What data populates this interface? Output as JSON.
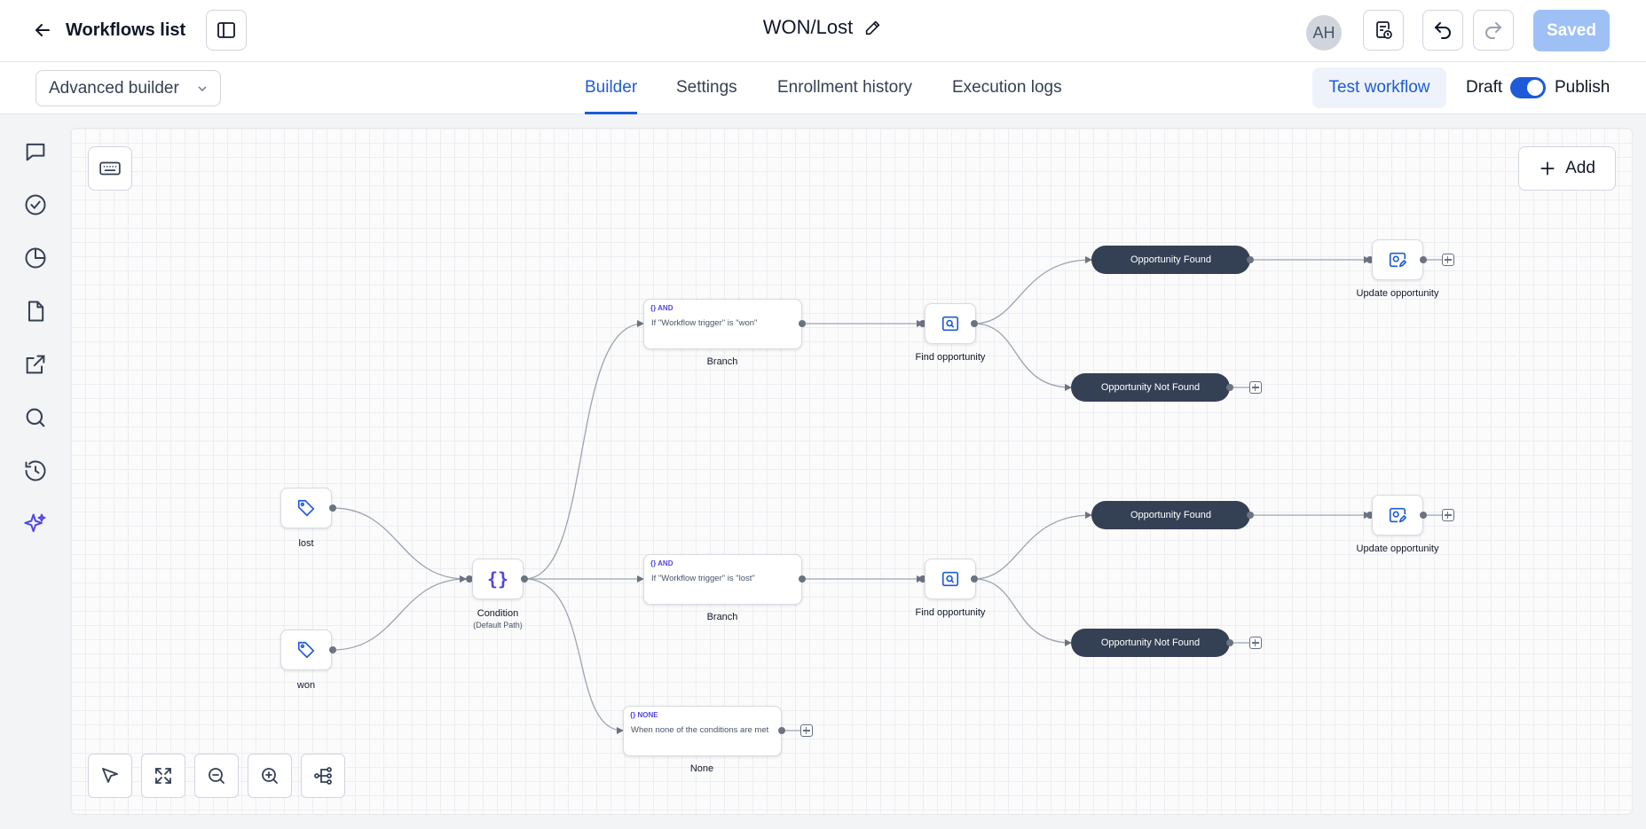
{
  "header": {
    "back_label": "Workflows list",
    "workflow_title": "WON/Lost",
    "avatar_initials": "AH",
    "saved_label": "Saved"
  },
  "nav": {
    "builder_select": "Advanced builder",
    "tabs": [
      {
        "label": "Builder",
        "active": true
      },
      {
        "label": "Settings",
        "active": false
      },
      {
        "label": "Enrollment history",
        "active": false
      },
      {
        "label": "Execution logs",
        "active": false
      }
    ],
    "test_workflow_label": "Test workflow",
    "draft_label": "Draft",
    "publish_label": "Publish",
    "publish_toggle_on": true
  },
  "sidebar": {
    "icons": [
      "chat-bubble-icon",
      "check-circle-icon",
      "pie-chart-icon",
      "document-icon",
      "external-link-icon",
      "search-icon",
      "history-icon",
      "sparkle-icon"
    ]
  },
  "canvas": {
    "add_label": "Add",
    "nodes": {
      "trigger_lost": "lost",
      "trigger_won": "won",
      "condition": "Condition",
      "condition_sub": "(Default Path)",
      "branch_won_tag": "AND",
      "branch_won_text": "If \"Workflow trigger\" is \"won\"",
      "branch_won_label": "Branch",
      "branch_lost_tag": "AND",
      "branch_lost_text": "If \"Workflow trigger\" is \"lost\"",
      "branch_lost_label": "Branch",
      "branch_none_tag": "NONE",
      "branch_none_text": "When none of the conditions are met",
      "branch_none_label": "None",
      "find_opportunity_1": "Find opportunity",
      "find_opportunity_2": "Find opportunity",
      "found_1": "Opportunity Found",
      "not_found_1": "Opportunity Not Found",
      "found_2": "Opportunity Found",
      "not_found_2": "Opportunity Not Found",
      "update_opportunity_1": "Update opportunity",
      "update_opportunity_2": "Update opportunity"
    }
  },
  "colors": {
    "accent": "#1d5bd8",
    "pill": "#344054",
    "condition_icon": "#4f46e5"
  }
}
